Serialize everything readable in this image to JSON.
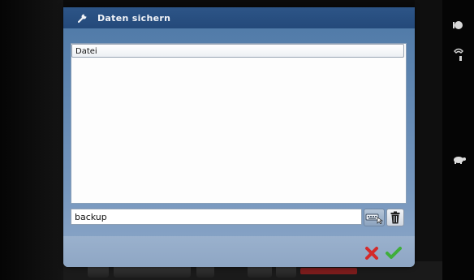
{
  "dialog": {
    "title": "Daten sichern",
    "title_icon": "wrench-icon"
  },
  "file_list": {
    "column_header": "Datei",
    "items": []
  },
  "filename_input": {
    "value": "backup"
  },
  "buttons": {
    "keyboard": "keyboard-icon",
    "delete": "trash-icon",
    "cancel": "close-icon",
    "confirm": "checkmark-icon"
  },
  "colors": {
    "titlebar": "#2d5587",
    "dialog_body": "#7596bd",
    "cancel": "#d42a2a",
    "confirm": "#3fae3a"
  }
}
